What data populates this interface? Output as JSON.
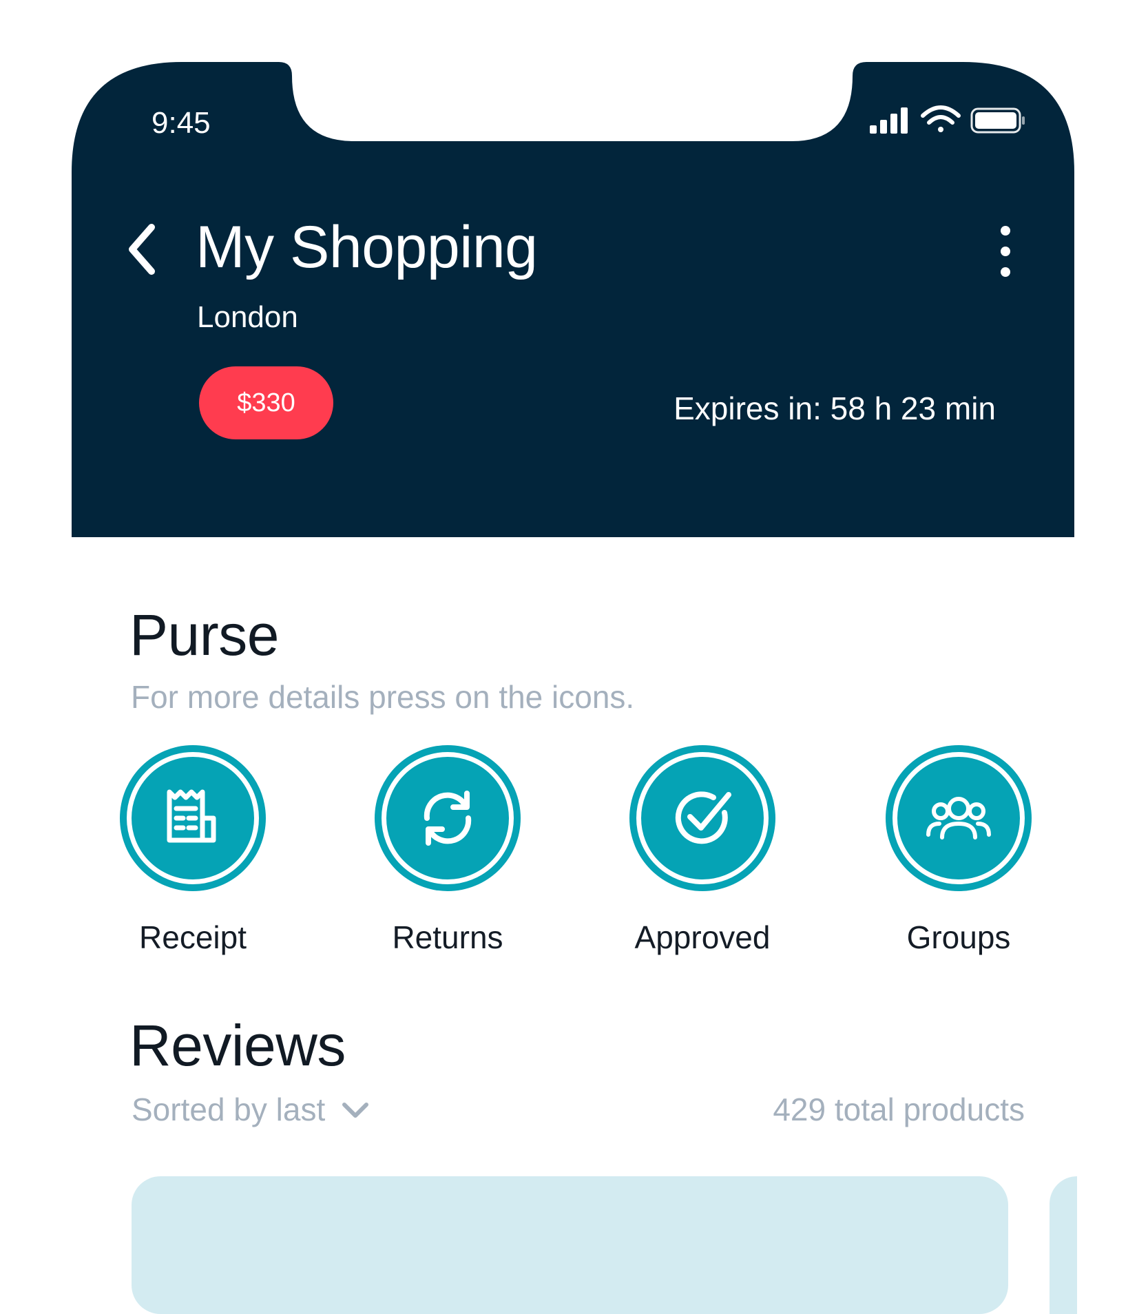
{
  "status_bar": {
    "time": "9:45"
  },
  "header": {
    "title": "My Shopping",
    "subtitle": "London",
    "price": "$330",
    "expires": "Expires in: 58 h 23 min",
    "background_color": "#02253b"
  },
  "purse": {
    "title": "Purse",
    "hint": "For more details press on the icons.",
    "accent_color": "#05a3b5",
    "items": [
      {
        "label": "Receipt",
        "icon": "receipt-icon"
      },
      {
        "label": "Returns",
        "icon": "refresh-icon"
      },
      {
        "label": "Approved",
        "icon": "check-circle-icon"
      },
      {
        "label": "Groups",
        "icon": "users-icon"
      }
    ]
  },
  "reviews": {
    "title": "Reviews",
    "sort_label": "Sorted by last",
    "total": "429 total products"
  },
  "colors": {
    "price_badge": "#ff3c4f",
    "muted_text": "#a4b0bd",
    "card_bg": "#d3ebf1"
  }
}
